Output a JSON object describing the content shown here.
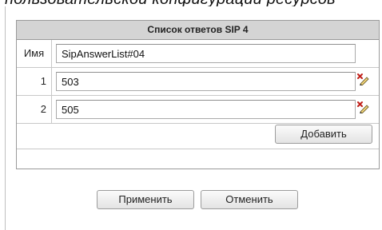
{
  "header": {
    "partial_text": "пользовательской конфигурации ресурсов"
  },
  "panel": {
    "title": "Список ответов SIP 4",
    "name_label": "Имя",
    "name_value": "SipAnswerList#04",
    "rows": [
      {
        "index": "1",
        "value": "503"
      },
      {
        "index": "2",
        "value": "505"
      }
    ],
    "add_label": "Добавить"
  },
  "footer": {
    "apply_label": "Применить",
    "cancel_label": "Отменить"
  },
  "icons": {
    "row_delete": "delete-edit-icon"
  },
  "colors": {
    "header_bg": "#d4d4d4",
    "border": "#9a9a9a",
    "delete_red": "#c0201a"
  }
}
